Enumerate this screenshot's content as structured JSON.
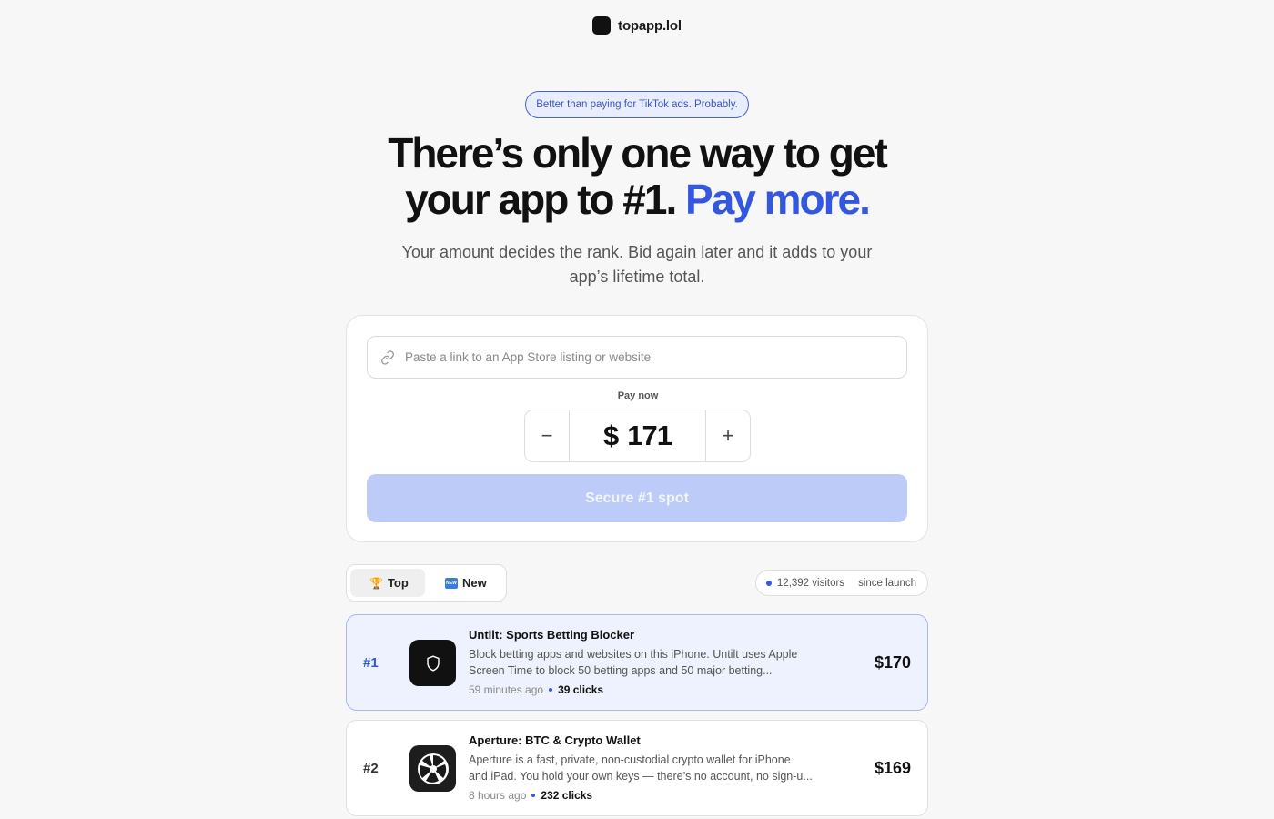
{
  "brand": {
    "name": "topapp.lol",
    "logo_icon": "rounded-square-logo"
  },
  "hero": {
    "pill": "Better than paying for TikTok ads. Probably.",
    "headline_line1": "There’s only one way to get",
    "headline_line2_prefix": "your app to #1.",
    "headline_accent": "Pay more.",
    "subhead_line1": "Your amount decides the rank. Bid again later and it adds to your",
    "subhead_line2": "app’s lifetime total."
  },
  "form": {
    "link_placeholder": "Paste a link to an App Store listing or website",
    "link_value": "",
    "pay_label": "Pay now",
    "currency": "$",
    "amount": "171",
    "minus": "−",
    "plus": "+",
    "submit": "Secure #1 spot"
  },
  "tabs": [
    {
      "emoji": "🏆",
      "label": "Top",
      "active": true
    },
    {
      "emoji_badge": "NEW",
      "label": "New",
      "active": false
    }
  ],
  "visitors": {
    "count": "12,392 visitors",
    "suffix": "since launch"
  },
  "apps": [
    {
      "rank": "#1",
      "icon": "shield-icon",
      "name": "Untilt: Sports Betting Blocker",
      "desc_line1": "Block betting apps and websites on this iPhone. Untilt uses Apple",
      "desc_line2": "Screen Time to block 50 betting apps and 50 major betting...",
      "time": "59 minutes ago",
      "clicks": "39 clicks",
      "price": "$170"
    },
    {
      "rank": "#2",
      "icon": "aperture-icon",
      "name": "Aperture: BTC & Crypto Wallet",
      "desc_line1": "Aperture is a fast, private, non-custodial crypto wallet for iPhone",
      "desc_line2": "and iPad. You hold your own keys — there’s no account, no sign-u...",
      "time": "8 hours ago",
      "clicks": "232 clicks",
      "price": "$169"
    }
  ],
  "colors": {
    "accent": "#3457e0",
    "button_disabled": "#bccbf8",
    "highlight_row": "#eef1fe"
  }
}
